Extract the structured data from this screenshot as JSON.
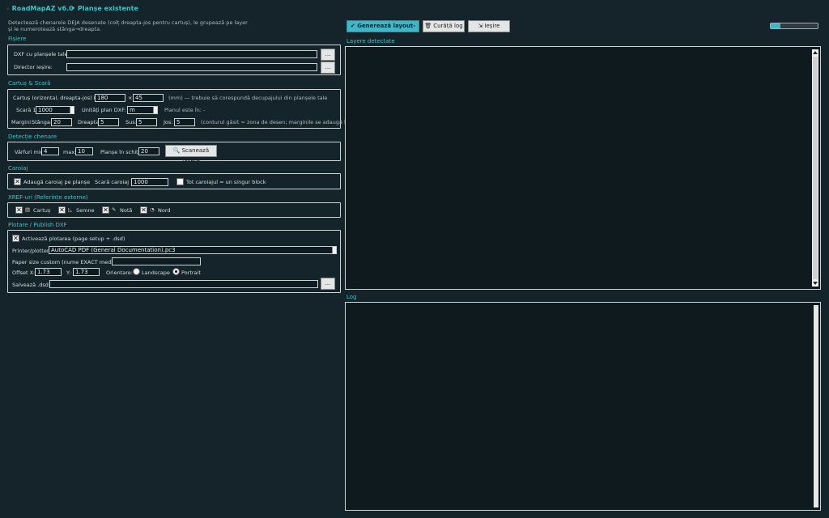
{
  "header": {
    "app_title": "RoadMapAZ v6.0",
    "page_title": "Planșe existente",
    "description_line1": "Detectează chenarele DEJA desenate (colț dreapta-jos pentru cartuș), le grupează pe layer",
    "description_line2": "și le numerotează stânga→dreapta."
  },
  "toolbar": {
    "generate_label": "✔ Generează layout-urile",
    "clear_log_label": "Curăță log",
    "exit_label": "Ieșire",
    "progress": 0.2
  },
  "files": {
    "section_title": "Fișiere",
    "dxf_label": "DXF cu planșele tale:",
    "dxf_value": "",
    "browse1": "...",
    "out_label": "Director ieșire:",
    "out_value": "",
    "browse2": "..."
  },
  "cartus": {
    "section_title": "Cartuș & Scară",
    "size_label": "Cartuș (orizontal, dreapta-jos) L×Î:",
    "width": "180",
    "x_sep": "×",
    "height": "45",
    "size_note": "(mm) — trebuie să corespundă decupajului din planșele tale",
    "scale_label": "Scară 1:",
    "scale_value": "1000",
    "units_label": "Unități plan DXF:",
    "units_value": "m",
    "plan_in_label": "Planul este în: -",
    "margins_label": "Margini",
    "left_label": "Stânga:",
    "left_value": "20",
    "right_label": "Dreapta:",
    "right_value": "5",
    "top_label": "Sus:",
    "top_value": "5",
    "bottom_label": "Jos:",
    "bottom_value": "5",
    "margins_note": "(conturul găsit = zona de desen; marginile se adaugă în jur)"
  },
  "detect": {
    "section_title": "Detecție chenare",
    "min_label": "Vârfuri min:",
    "min_value": "4",
    "max_label": "max:",
    "max_value": "10",
    "sketch_label": "Planșe în schiță:",
    "sketch_value": "20",
    "scan_label": "Scanează layere"
  },
  "grid": {
    "section_title": "Caroiaj",
    "add_label": "Adaugă caroiaj pe planșe",
    "add_checked": true,
    "scale_label": "Scară caroiaj 1:",
    "scale_value": "1000",
    "block_label": "Tot caroiajul = un singur block",
    "block_checked": false
  },
  "xref": {
    "section_title": "XREF-uri (Referințe externe)",
    "items": [
      {
        "label": "Cartuș",
        "icon": "document-icon",
        "glyph": "▤"
      },
      {
        "label": "Semne",
        "icon": "triangle-ruler-icon",
        "glyph": "◺"
      },
      {
        "label": "Notă",
        "icon": "note-icon",
        "glyph": "✎"
      },
      {
        "label": "Nord",
        "icon": "compass-icon",
        "glyph": "◔"
      }
    ]
  },
  "plot": {
    "section_title": "Plotare / Publish DXF",
    "enable_label": "Activează plotarea (page setup + .dsd)",
    "printer_label": "Printer/plotter:",
    "printer_value": "AutoCAD PDF (General Documentation).pc3",
    "paper_label": "Paper size custom (nume EXACT media):",
    "paper_value": "",
    "offx_label": "Offset X:",
    "offx_value": "1.73",
    "offy_label": "Y:",
    "offy_value": "1.73",
    "orient_label": "Orientare:",
    "landscape_label": "Landscape",
    "portrait_label": "Portrait",
    "dsd_label": "Salvează .dsd:",
    "dsd_value": "",
    "browse3": "..."
  },
  "right": {
    "layers_title": "Layere detectate",
    "log_title": "Log"
  }
}
